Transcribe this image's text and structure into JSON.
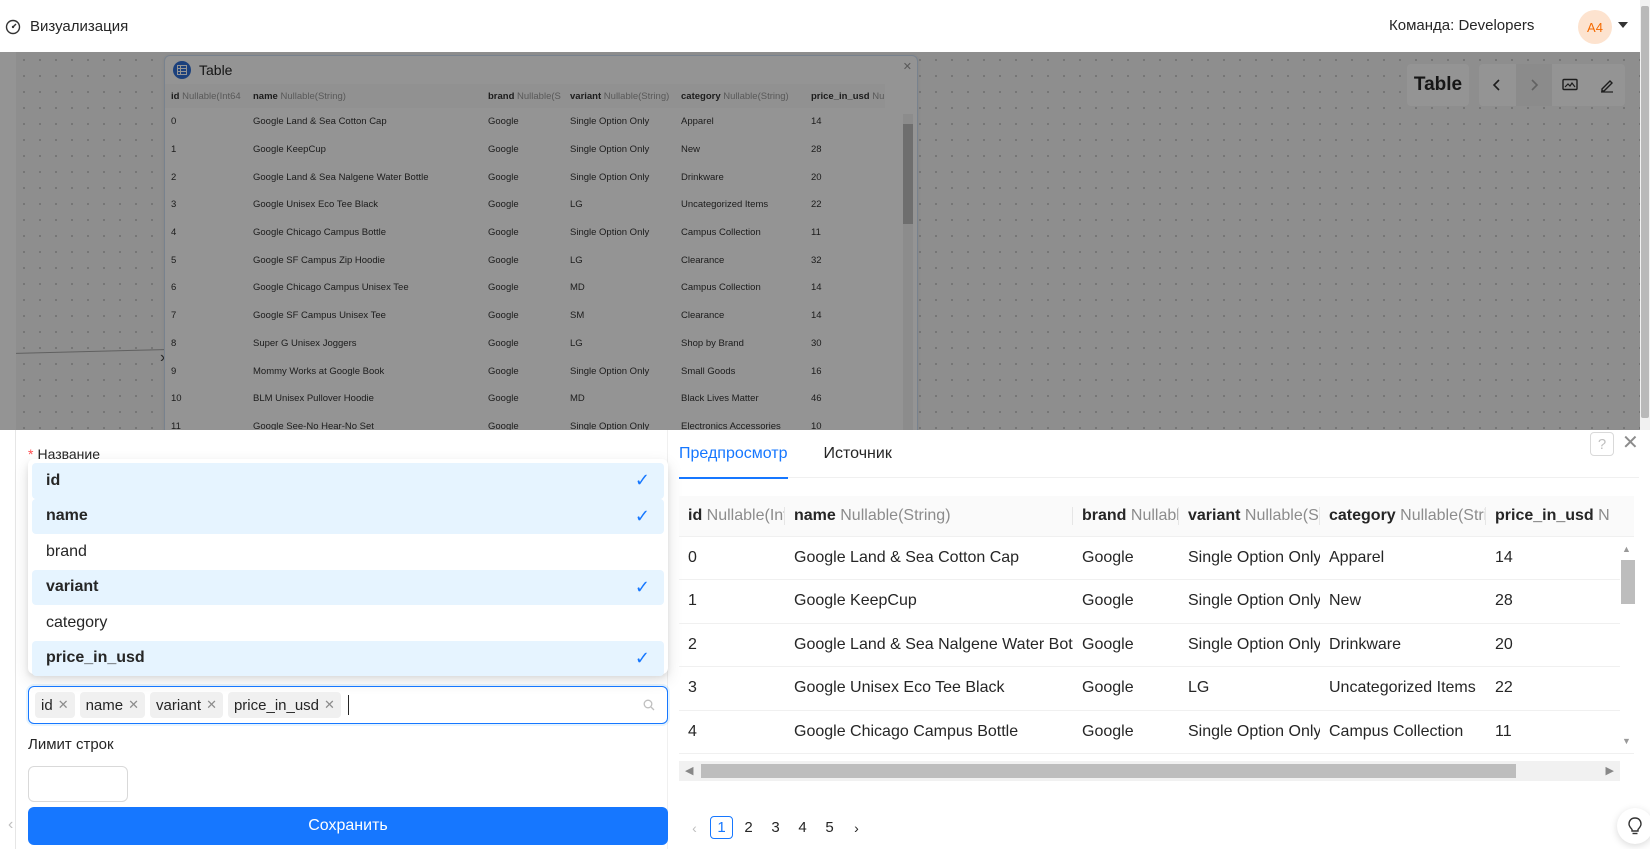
{
  "topbar": {
    "title": "Визуализация",
    "team_label": "Команда: Developers",
    "avatar_initials": "A4"
  },
  "node": {
    "title": "Table",
    "columns": [
      {
        "name": "id",
        "type": "Nullable(Int64"
      },
      {
        "name": "name",
        "type": "Nullable(String)"
      },
      {
        "name": "brand",
        "type": "Nullable(S"
      },
      {
        "name": "variant",
        "type": "Nullable(String)"
      },
      {
        "name": "category",
        "type": "Nullable(String)"
      },
      {
        "name": "price_in_usd",
        "type": "Nulla"
      }
    ],
    "rows": [
      [
        "0",
        "Google Land & Sea Cotton Cap",
        "Google",
        "Single Option Only",
        "Apparel",
        "14"
      ],
      [
        "1",
        "Google KeepCup",
        "Google",
        "Single Option Only",
        "New",
        "28"
      ],
      [
        "2",
        "Google Land & Sea Nalgene Water Bottle",
        "Google",
        "Single Option Only",
        "Drinkware",
        "20"
      ],
      [
        "3",
        "Google Unisex Eco Tee Black",
        "Google",
        "LG",
        "Uncategorized Items",
        "22"
      ],
      [
        "4",
        "Google Chicago Campus Bottle",
        "Google",
        "Single Option Only",
        "Campus Collection",
        "11"
      ],
      [
        "5",
        "Google SF Campus Zip Hoodie",
        "Google",
        "LG",
        "Clearance",
        "32"
      ],
      [
        "6",
        "Google Chicago Campus Unisex Tee",
        "Google",
        "MD",
        "Campus Collection",
        "14"
      ],
      [
        "7",
        "Google SF Campus Unisex Tee",
        "Google",
        "SM",
        "Clearance",
        "14"
      ],
      [
        "8",
        "Super G Unisex Joggers",
        "Google",
        "LG",
        "Shop by Brand",
        "30"
      ],
      [
        "9",
        "Mommy Works at Google Book",
        "Google",
        "Single Option Only",
        "Small Goods",
        "16"
      ],
      [
        "10",
        "BLM Unisex Pullover Hoodie",
        "Google",
        "MD",
        "Black Lives Matter",
        "46"
      ],
      [
        "11",
        "Google See-No Hear-No Set",
        "Google",
        "Single Option Only",
        "Electronics Accessories",
        "10"
      ]
    ]
  },
  "toolbar": {
    "type_label": "Table",
    "icons": [
      "chevron-left-icon",
      "chevron-right-icon",
      "image-icon",
      "edit-icon"
    ]
  },
  "form": {
    "name_label": "Название",
    "columns_dropdown": {
      "options": [
        {
          "label": "id",
          "selected": true
        },
        {
          "label": "name",
          "selected": true
        },
        {
          "label": "brand",
          "selected": false
        },
        {
          "label": "variant",
          "selected": true
        },
        {
          "label": "category",
          "selected": false
        },
        {
          "label": "price_in_usd",
          "selected": true
        }
      ]
    },
    "tags": [
      "id",
      "name",
      "variant",
      "price_in_usd"
    ],
    "limit_label": "Лимит строк",
    "limit_value": "",
    "save_label": "Сохранить"
  },
  "preview": {
    "tabs": [
      {
        "label": "Предпросмотр",
        "active": true
      },
      {
        "label": "Источник",
        "active": false
      }
    ],
    "help_label": "?",
    "columns": [
      {
        "name": "id",
        "type": "Nullable(Int"
      },
      {
        "name": "name",
        "type": "Nullable(String)"
      },
      {
        "name": "brand",
        "type": "Nullable"
      },
      {
        "name": "variant",
        "type": "Nullable(Stri"
      },
      {
        "name": "category",
        "type": "Nullable(Strin"
      },
      {
        "name": "price_in_usd",
        "type": "N"
      }
    ],
    "rows": [
      [
        "0",
        "Google Land & Sea Cotton Cap",
        "Google",
        "Single Option Only",
        "Apparel",
        "14"
      ],
      [
        "1",
        "Google KeepCup",
        "Google",
        "Single Option Only",
        "New",
        "28"
      ],
      [
        "2",
        "Google Land & Sea Nalgene Water Bottle",
        "Google",
        "Single Option Only",
        "Drinkware",
        "20"
      ],
      [
        "3",
        "Google Unisex Eco Tee Black",
        "Google",
        "LG",
        "Uncategorized Items",
        "22"
      ],
      [
        "4",
        "Google Chicago Campus Bottle",
        "Google",
        "Single Option Only",
        "Campus Collection",
        "11"
      ]
    ],
    "pages": [
      "1",
      "2",
      "3",
      "4",
      "5"
    ],
    "current_page": "1"
  },
  "colors": {
    "accent": "#1677ff",
    "selected_bg": "#e6f4ff",
    "required": "#ff4d4f"
  }
}
